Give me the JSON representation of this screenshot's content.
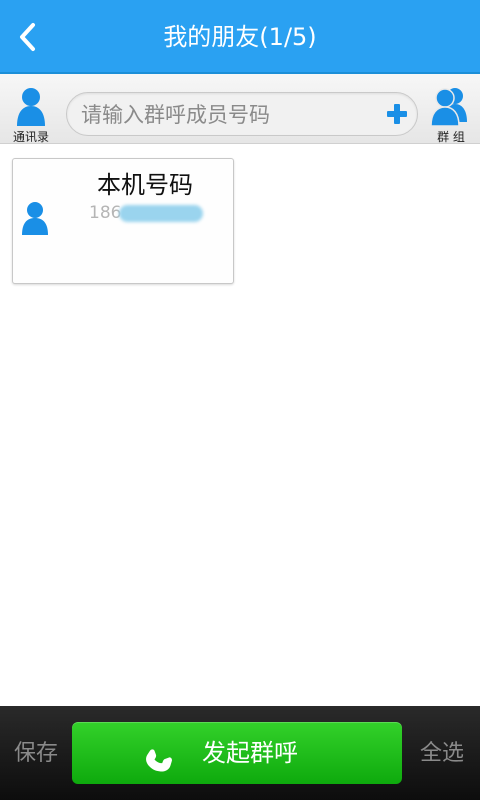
{
  "header": {
    "title": "我的朋友(1/5)",
    "back_icon": "chevron-left-icon"
  },
  "searchbar": {
    "contacts_label": "通讯录",
    "placeholder": "请输入群呼成员号码",
    "add_icon": "plus-icon",
    "group_label": "群 组"
  },
  "contacts": [
    {
      "name": "本机号码",
      "number_visible": "186"
    }
  ],
  "footer": {
    "save_label": "保存",
    "call_label": "发起群呼",
    "select_all_label": "全选"
  },
  "colors": {
    "header_blue": "#2aa1f2",
    "call_green": "#1cbd18",
    "avatar_blue": "#1a8fe6"
  }
}
